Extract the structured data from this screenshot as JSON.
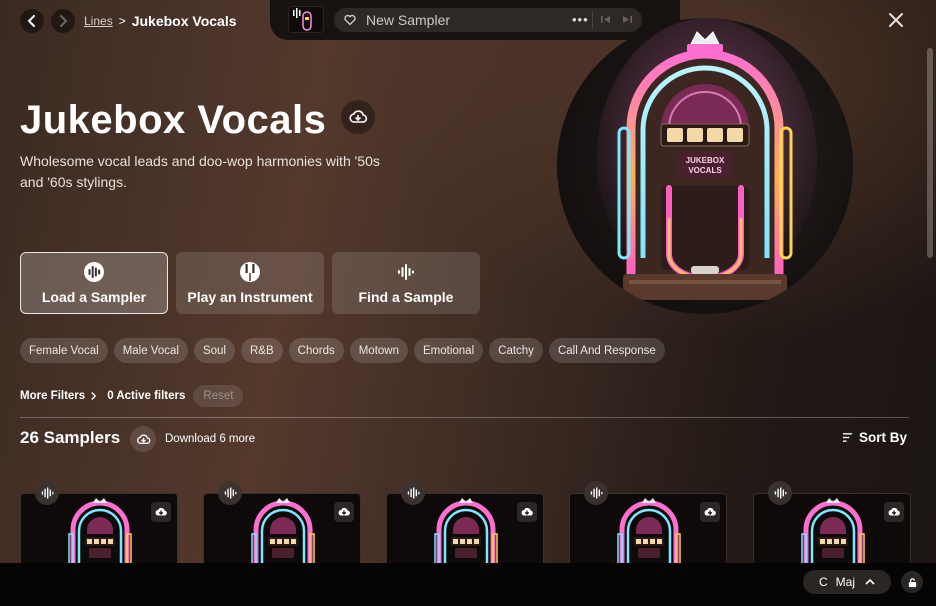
{
  "breadcrumb": {
    "parent": "Lines",
    "separator": ">",
    "current": "Jukebox Vocals"
  },
  "player": {
    "sampler_name": "New Sampler",
    "more": "•••"
  },
  "pack": {
    "title": "Jukebox Vocals",
    "description": "Wholesome vocal leads and doo-wop harmonies with '50s and '60s stylings.",
    "art_text": [
      "JUKEBOX",
      "VOCALS"
    ]
  },
  "actions": [
    {
      "label": "Load a Sampler",
      "icon": "waveform-circle-icon",
      "active": true
    },
    {
      "label": "Play an Instrument",
      "icon": "piano-keys-icon",
      "active": false
    },
    {
      "label": "Find a Sample",
      "icon": "waveform-icon",
      "active": false
    }
  ],
  "tags": [
    "Female Vocal",
    "Male Vocal",
    "Soul",
    "R&B",
    "Chords",
    "Motown",
    "Emotional",
    "Catchy",
    "Call And Response"
  ],
  "filters": {
    "more_label": "More Filters",
    "active_label": "0 Active filters",
    "reset_label": "Reset"
  },
  "results": {
    "count_label": "26 Samplers",
    "download_label": "Download 6 more",
    "sort_label": "Sort By"
  },
  "cards": 5,
  "key": {
    "root": "C",
    "mode": "Maj"
  },
  "colors": {
    "accent_pink": "#ff5ec4",
    "accent_cyan": "#7ce8ff",
    "accent_gold": "#ffd34d",
    "panel": "#2e2926"
  }
}
